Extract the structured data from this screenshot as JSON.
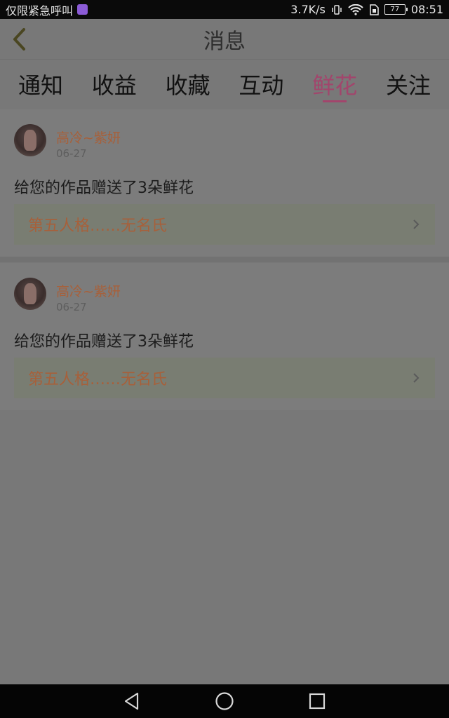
{
  "status_bar": {
    "left_text": "仅限紧急呼叫",
    "speed": "3.7K/s",
    "battery": "77",
    "time": "08:51"
  },
  "header": {
    "title": "消息"
  },
  "tabs": [
    {
      "label": "通知"
    },
    {
      "label": "收益"
    },
    {
      "label": "收藏"
    },
    {
      "label": "互动"
    },
    {
      "label": "鲜花",
      "active": true
    },
    {
      "label": "关注"
    }
  ],
  "messages": [
    {
      "sender": "高冷~紫妍",
      "date": "06-27",
      "text": "给您的作品赠送了3朵鲜花",
      "work_title": "第五人格……无名氏"
    },
    {
      "sender": "高冷~紫妍",
      "date": "06-27",
      "text": "给您的作品赠送了3朵鲜花",
      "work_title": "第五人格……无名氏"
    }
  ],
  "colors": {
    "accent": "#a2456c",
    "sender": "#a7603a"
  },
  "icons": {
    "back": "chevron-left-icon",
    "nav": [
      "back-triangle-icon",
      "home-circle-icon",
      "recents-square-icon"
    ]
  }
}
